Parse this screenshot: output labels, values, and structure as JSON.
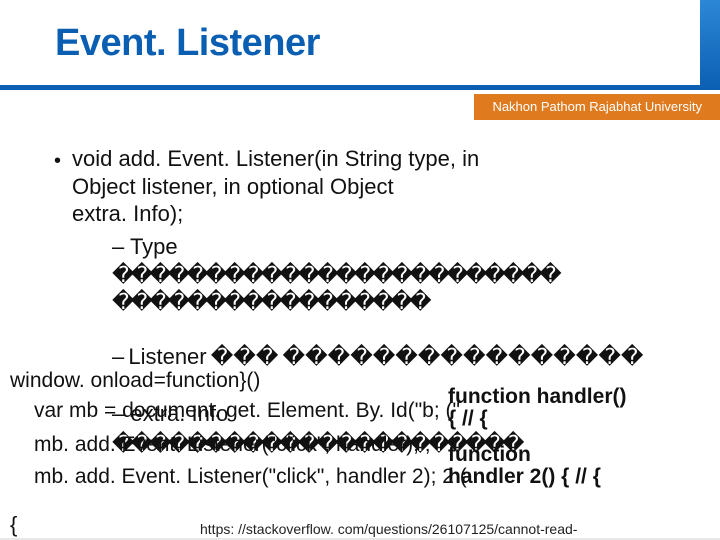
{
  "header": {
    "title": "Event. Listener",
    "university": "Nakhon Pathom Rajabhat University"
  },
  "bullet": {
    "line1": "void add. Event. Listener(in String type, in",
    "line2": "Object listener,                  in optional Object",
    "line3": "extra. Info);"
  },
  "sub_type": {
    "label": "– Type",
    "ph1": "�������� ���� ������������",
    "ph2": "�����������������"
  },
  "sub_listener": {
    "label": "– Listener ��� ����������������"
  },
  "sub_extra": {
    "label": "– extra. Info",
    "ph": "���������� ������������"
  },
  "code": {
    "l1": "window. onload=function}()",
    "l2": "var mb = document. get. Element. By. Id(\"b; (\"",
    "l3": "mb. add. Event. Listener(\"click\", handler); ;",
    "l4": "mb. add. Event. Listener(\"click\", handler 2); 2 ("
  },
  "overlay": {
    "o1": "function handler()",
    "o2": "{ // {",
    "o3": "function",
    "o4": "handler 2() { // {"
  },
  "brace": "{",
  "footer": "https: //stackoverflow. com/questions/26107125/cannot-read-"
}
